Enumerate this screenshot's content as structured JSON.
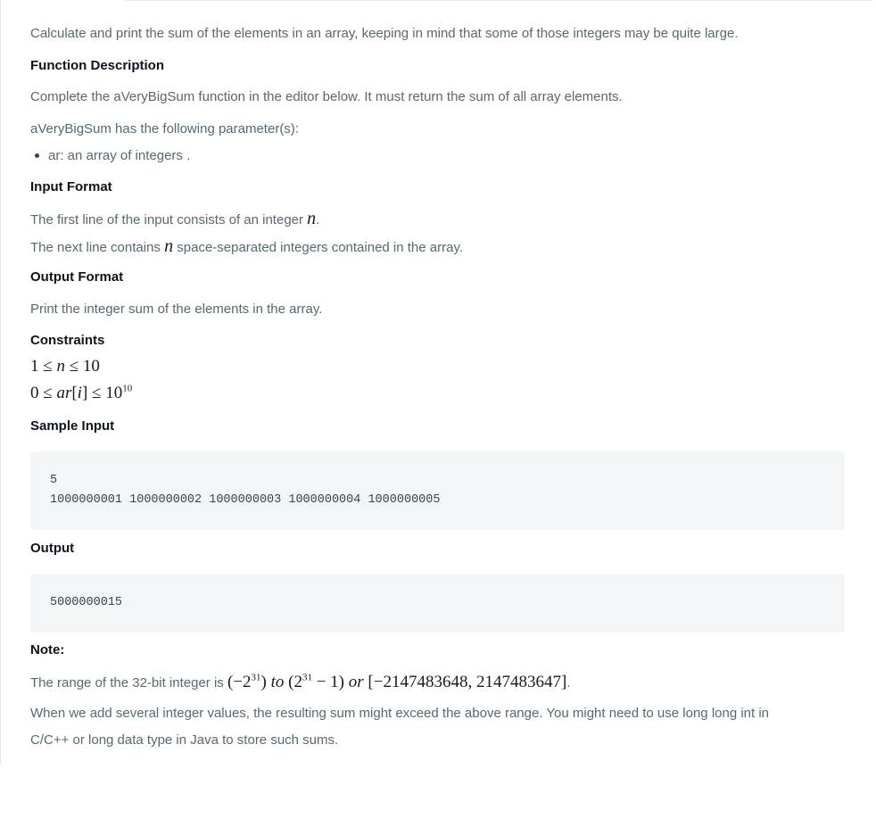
{
  "intro": "Calculate and print the sum of the elements in an array, keeping in mind that some of those integers may be quite large.",
  "function_description": {
    "heading": "Function Description",
    "text": "Complete the aVeryBigSum function in the editor below. It must return the sum of all array elements.",
    "params_intro": "aVeryBigSum has the following parameter(s):",
    "params": [
      "ar: an array of integers ."
    ]
  },
  "input_format": {
    "heading": "Input Format",
    "line1_prefix": "The first line of the input consists of an integer ",
    "line1_var": "n",
    "line1_suffix": ".",
    "line2_prefix": "The next line contains ",
    "line2_var": "n",
    "line2_suffix": " space-separated integers contained in the array."
  },
  "output_format": {
    "heading": "Output Format",
    "text": "Print the integer sum of the elements in the array."
  },
  "constraints": {
    "heading": "Constraints",
    "c1": {
      "lo": "1",
      "op1": "≤",
      "var": "n",
      "op2": "≤",
      "hi": "10"
    },
    "c2": {
      "lo": "0",
      "op1": "≤",
      "var": "ar",
      "idx": "i",
      "op2": "≤",
      "base": "10",
      "exp": "10"
    }
  },
  "sample_input": {
    "heading": "Sample Input",
    "line1": "5",
    "line2": "1000000001 1000000002 1000000003 1000000004 1000000005"
  },
  "output": {
    "heading": "Output",
    "value": "5000000015"
  },
  "note": {
    "heading": "Note:",
    "range_prefix": "The range of the 32-bit integer is ",
    "range_math": {
      "m1": "(−2",
      "e1": "31",
      "m2": ") ",
      "t1": "to",
      "m3": " (2",
      "e2": "31",
      "m4": " − 1) ",
      "t2": "or",
      "m5": " [−2147483648, 2147483647]",
      "end": "."
    },
    "line2": "When we add several integer values, the resulting sum might exceed the above range. You might need to use long long int in",
    "line3": "C/C++ or long data type in Java to store such sums."
  }
}
